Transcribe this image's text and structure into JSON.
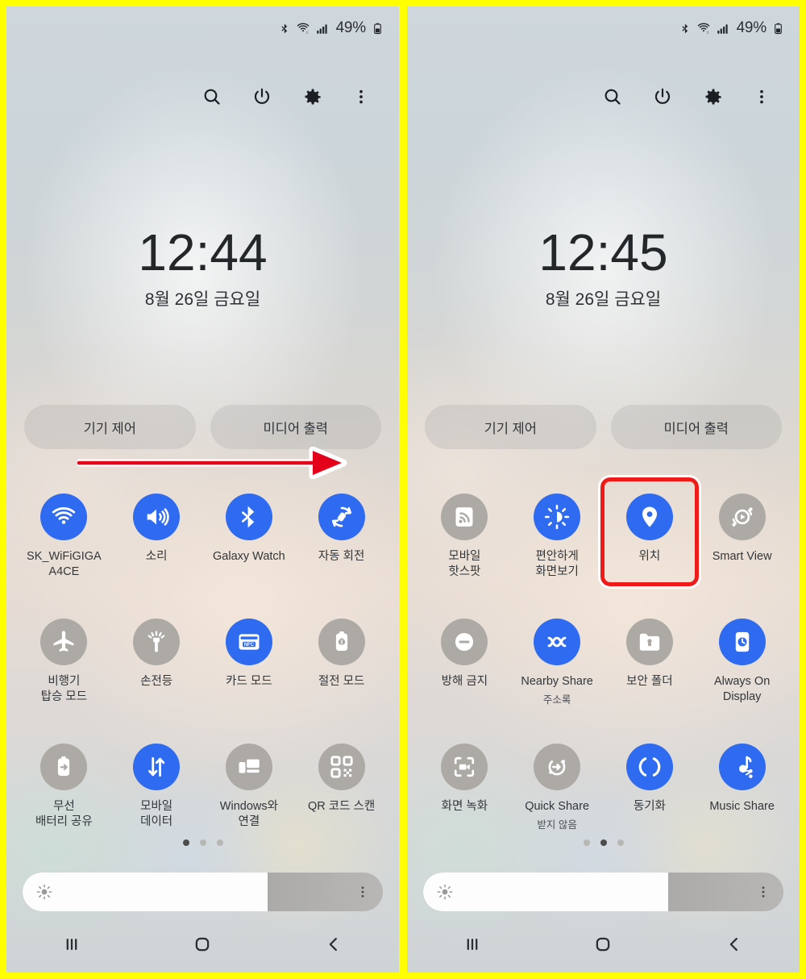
{
  "annotation": {
    "frame_color": "#ffff00",
    "arrow_color": "#e4001b",
    "highlight_color": "#f01a18"
  },
  "panels": [
    {
      "id": "panel-left",
      "status_bar": {
        "bluetooth_icon": "bluetooth-icon",
        "wifi_icon": "wifi-icon",
        "signal_icon": "signal-bars-icon",
        "battery_percent": "49%",
        "battery_icon": "battery-icon"
      },
      "header_icons": [
        {
          "name": "search-icon",
          "label": "Search"
        },
        {
          "name": "power-icon",
          "label": "Power"
        },
        {
          "name": "gear-icon",
          "label": "Settings"
        },
        {
          "name": "more-vertical-icon",
          "label": "More options"
        }
      ],
      "clock": {
        "time": "12:44",
        "date": "8월 26일 금요일"
      },
      "pills": [
        {
          "name": "device-control-button",
          "label": "기기 제어"
        },
        {
          "name": "media-output-button",
          "label": "미디어 출력"
        }
      ],
      "tiles": [
        {
          "name": "tile-wifi",
          "icon": "wifi-icon",
          "label": "SK_WiFiGIGA\nA4CE",
          "sub": "",
          "state": "on"
        },
        {
          "name": "tile-sound",
          "icon": "volume-icon",
          "label": "소리",
          "sub": "",
          "state": "on"
        },
        {
          "name": "tile-bluetooth",
          "icon": "bluetooth-icon",
          "label": "Galaxy Watch",
          "sub": "",
          "state": "on"
        },
        {
          "name": "tile-auto-rotate",
          "icon": "auto-rotate-icon",
          "label": "자동 회전",
          "sub": "",
          "state": "on"
        },
        {
          "name": "tile-airplane-mode",
          "icon": "airplane-icon",
          "label": "비행기\n탑승 모드",
          "sub": "",
          "state": "off"
        },
        {
          "name": "tile-flashlight",
          "icon": "flashlight-icon",
          "label": "손전등",
          "sub": "",
          "state": "off"
        },
        {
          "name": "tile-card-mode",
          "icon": "nfc-card-icon",
          "label": "카드 모드",
          "sub": "",
          "state": "on"
        },
        {
          "name": "tile-power-saving",
          "icon": "battery-leaf-icon",
          "label": "절전 모드",
          "sub": "",
          "state": "off"
        },
        {
          "name": "tile-wireless-power-share",
          "icon": "battery-share-icon",
          "label": "무선\n배터리 공유",
          "sub": "",
          "state": "off"
        },
        {
          "name": "tile-mobile-data",
          "icon": "data-arrows-icon",
          "label": "모바일\n데이터",
          "sub": "",
          "state": "on"
        },
        {
          "name": "tile-link-to-windows",
          "icon": "link-windows-icon",
          "label": "Windows와\n연결",
          "sub": "",
          "state": "off"
        },
        {
          "name": "tile-qr-scan",
          "icon": "qr-code-icon",
          "label": "QR 코드 스캔",
          "sub": "",
          "state": "off"
        }
      ],
      "page_dots": {
        "count": 3,
        "active": 0
      },
      "brightness": {
        "percent": 68,
        "sun_icon": "brightness-sun-icon",
        "more_icon": "more-vertical-icon"
      },
      "nav": [
        {
          "name": "nav-recents-button",
          "icon": "recents-icon"
        },
        {
          "name": "nav-home-button",
          "icon": "home-icon"
        },
        {
          "name": "nav-back-button",
          "icon": "back-chevron-icon"
        }
      ],
      "highlight_tile_index": null,
      "show_arrow": true
    },
    {
      "id": "panel-right",
      "status_bar": {
        "bluetooth_icon": "bluetooth-icon",
        "wifi_icon": "wifi-icon",
        "signal_icon": "signal-bars-icon",
        "battery_percent": "49%",
        "battery_icon": "battery-icon"
      },
      "header_icons": [
        {
          "name": "search-icon",
          "label": "Search"
        },
        {
          "name": "power-icon",
          "label": "Power"
        },
        {
          "name": "gear-icon",
          "label": "Settings"
        },
        {
          "name": "more-vertical-icon",
          "label": "More options"
        }
      ],
      "clock": {
        "time": "12:45",
        "date": "8월 26일 금요일"
      },
      "pills": [
        {
          "name": "device-control-button",
          "label": "기기 제어"
        },
        {
          "name": "media-output-button",
          "label": "미디어 출력"
        }
      ],
      "tiles": [
        {
          "name": "tile-mobile-hotspot",
          "icon": "hotspot-icon",
          "label": "모바일\n핫스팟",
          "sub": "",
          "state": "off"
        },
        {
          "name": "tile-eye-comfort-shield",
          "icon": "eye-comfort-icon",
          "label": "편안하게\n화면보기",
          "sub": "",
          "state": "on"
        },
        {
          "name": "tile-location",
          "icon": "location-pin-icon",
          "label": "위치",
          "sub": "",
          "state": "on"
        },
        {
          "name": "tile-smart-view",
          "icon": "smart-view-icon",
          "label": "Smart View",
          "sub": "",
          "state": "off"
        },
        {
          "name": "tile-do-not-disturb",
          "icon": "dnd-icon",
          "label": "방해 금지",
          "sub": "",
          "state": "off"
        },
        {
          "name": "tile-nearby-share",
          "icon": "nearby-share-icon",
          "label": "Nearby Share",
          "sub": "주소록",
          "state": "on"
        },
        {
          "name": "tile-secure-folder",
          "icon": "secure-folder-icon",
          "label": "보안 폴더",
          "sub": "",
          "state": "off"
        },
        {
          "name": "tile-always-on-display",
          "icon": "aod-clock-icon",
          "label": "Always On\nDisplay",
          "sub": "",
          "state": "on"
        },
        {
          "name": "tile-screen-recorder",
          "icon": "screen-record-icon",
          "label": "화면 녹화",
          "sub": "",
          "state": "off"
        },
        {
          "name": "tile-quick-share",
          "icon": "quick-share-icon",
          "label": "Quick Share",
          "sub": "받지 않음",
          "state": "off"
        },
        {
          "name": "tile-sync",
          "icon": "sync-icon",
          "label": "동기화",
          "sub": "",
          "state": "on"
        },
        {
          "name": "tile-music-share",
          "icon": "music-share-icon",
          "label": "Music Share",
          "sub": "",
          "state": "on"
        }
      ],
      "page_dots": {
        "count": 3,
        "active": 1
      },
      "brightness": {
        "percent": 68,
        "sun_icon": "brightness-sun-icon",
        "more_icon": "more-vertical-icon"
      },
      "nav": [
        {
          "name": "nav-recents-button",
          "icon": "recents-icon"
        },
        {
          "name": "nav-home-button",
          "icon": "home-icon"
        },
        {
          "name": "nav-back-button",
          "icon": "back-chevron-icon"
        }
      ],
      "highlight_tile_index": 2,
      "show_arrow": false
    }
  ]
}
